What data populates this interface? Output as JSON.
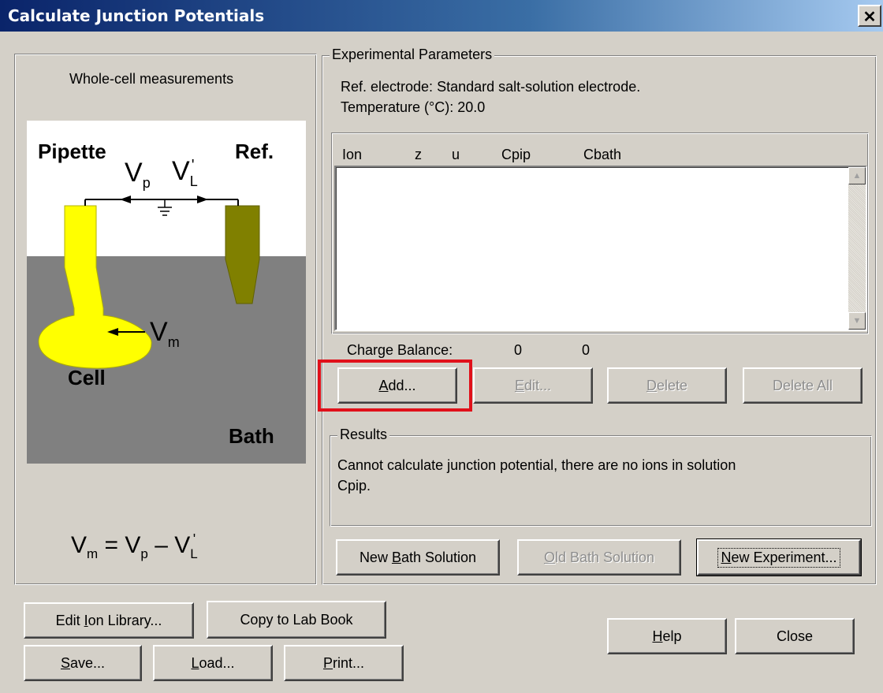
{
  "window": {
    "title": "Calculate Junction Potentials",
    "close_glyph": "✕"
  },
  "diagram": {
    "heading": "Whole-cell measurements",
    "label_pipette": "Pipette",
    "label_ref": "Ref.",
    "label_cell": "Cell",
    "label_bath": "Bath",
    "vp_main": "V",
    "vp_sub": "p",
    "vl_main": "V",
    "vl_sub": "L",
    "vl_prime": "'",
    "vm_main": "V",
    "vm_sub": "m",
    "equation": {
      "lhs_main": "V",
      "lhs_sub": "m",
      "eq": "=",
      "t1_main": "V",
      "t1_sub": "p",
      "minus": "–",
      "t2_main": "V",
      "t2_sub": "L",
      "t2_prime": "'"
    },
    "colors": {
      "pipette": "#ffff00",
      "ref": "#808000",
      "bath": "#808080",
      "background": "#ffffff"
    }
  },
  "experimental": {
    "group_label": "Experimental Parameters",
    "ref_electrode": "Ref. electrode: Standard salt-solution electrode.",
    "temperature": "Temperature (°C): 20.0",
    "columns": [
      "Ion",
      "z",
      "u",
      "Cpip",
      "Cbath"
    ],
    "charge_balance_label": "Charge Balance:",
    "charge_balance_pip": "0",
    "charge_balance_bath": "0",
    "add_label": "Add...",
    "add_ul": "A",
    "add_rest": "dd...",
    "edit_label": "Edit...",
    "edit_ul": "E",
    "edit_rest": "dit...",
    "delete_label": "Delete",
    "delete_ul": "D",
    "delete_rest": "elete",
    "delete_all_label": "Delete All"
  },
  "results": {
    "group_label": "Results",
    "line1": "Cannot calculate junction potential, there are no ions in solution",
    "line2": "Cpip."
  },
  "solution_buttons": {
    "new_bath_pre": "New ",
    "new_bath_ul": "B",
    "new_bath_post": "ath Solution",
    "old_bath_ul": "O",
    "old_bath_post": "ld Bath Solution",
    "new_exp_ul": "N",
    "new_exp_post": "ew Experiment..."
  },
  "bottom_buttons": {
    "edit_lib_pre": "Edit ",
    "edit_lib_ul": "I",
    "edit_lib_post": "on Library...",
    "copy_lab": "Copy to Lab Book",
    "save_ul": "S",
    "save_post": "ave...",
    "load_ul": "L",
    "load_post": "oad...",
    "print_ul": "P",
    "print_post": "rint...",
    "help_ul": "H",
    "help_post": "elp",
    "close": "Close"
  },
  "colors": {
    "window_bg": "#d4d0c8",
    "highlight": "#e0101a",
    "titlebar": "#0a246a"
  }
}
